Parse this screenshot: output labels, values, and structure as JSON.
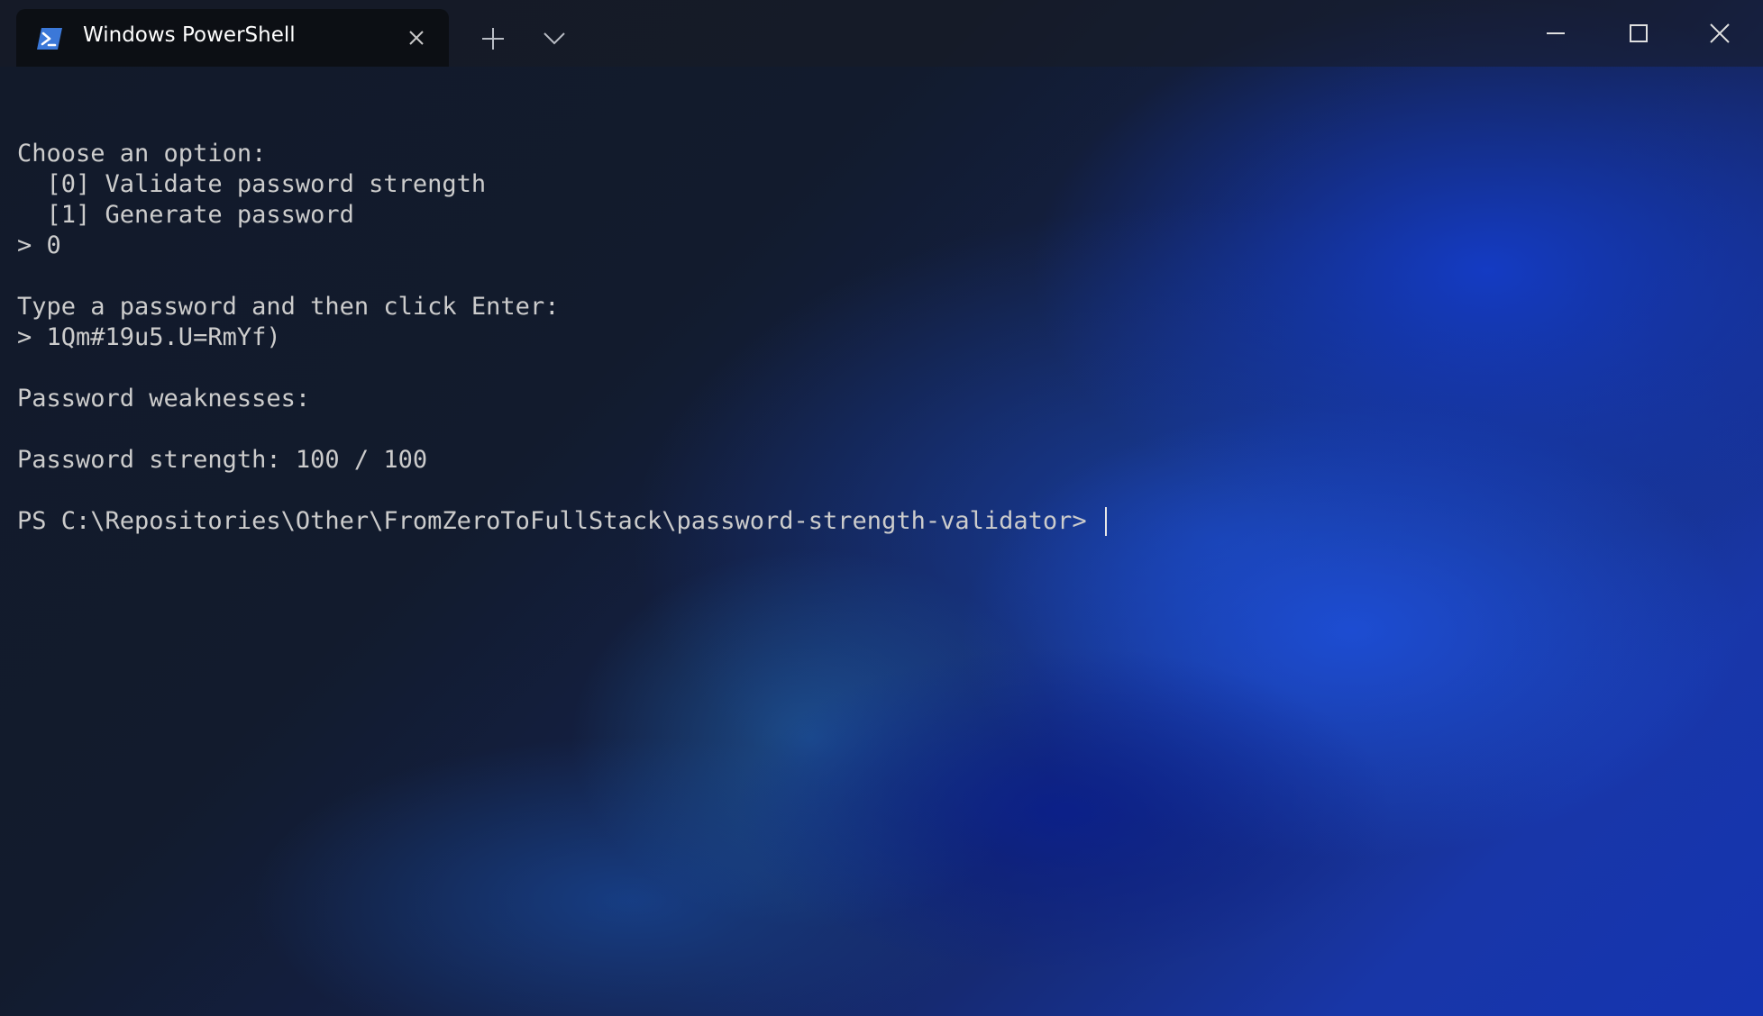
{
  "window": {
    "tab_title": "Windows PowerShell",
    "tab_icon": "powershell-icon",
    "accent_color": "#3b78d8"
  },
  "terminal": {
    "lines": [
      "",
      "Choose an option:",
      "  [0] Validate password strength",
      "  [1] Generate password",
      "> 0",
      "",
      "Type a password and then click Enter:",
      "> 1Qm#19u5.U=RmYf)",
      "",
      "Password weaknesses:",
      "",
      "Password strength: 100 / 100",
      ""
    ],
    "prompt": "PS C:\\Repositories\\Other\\FromZeroToFullStack\\password-strength-validator> "
  }
}
